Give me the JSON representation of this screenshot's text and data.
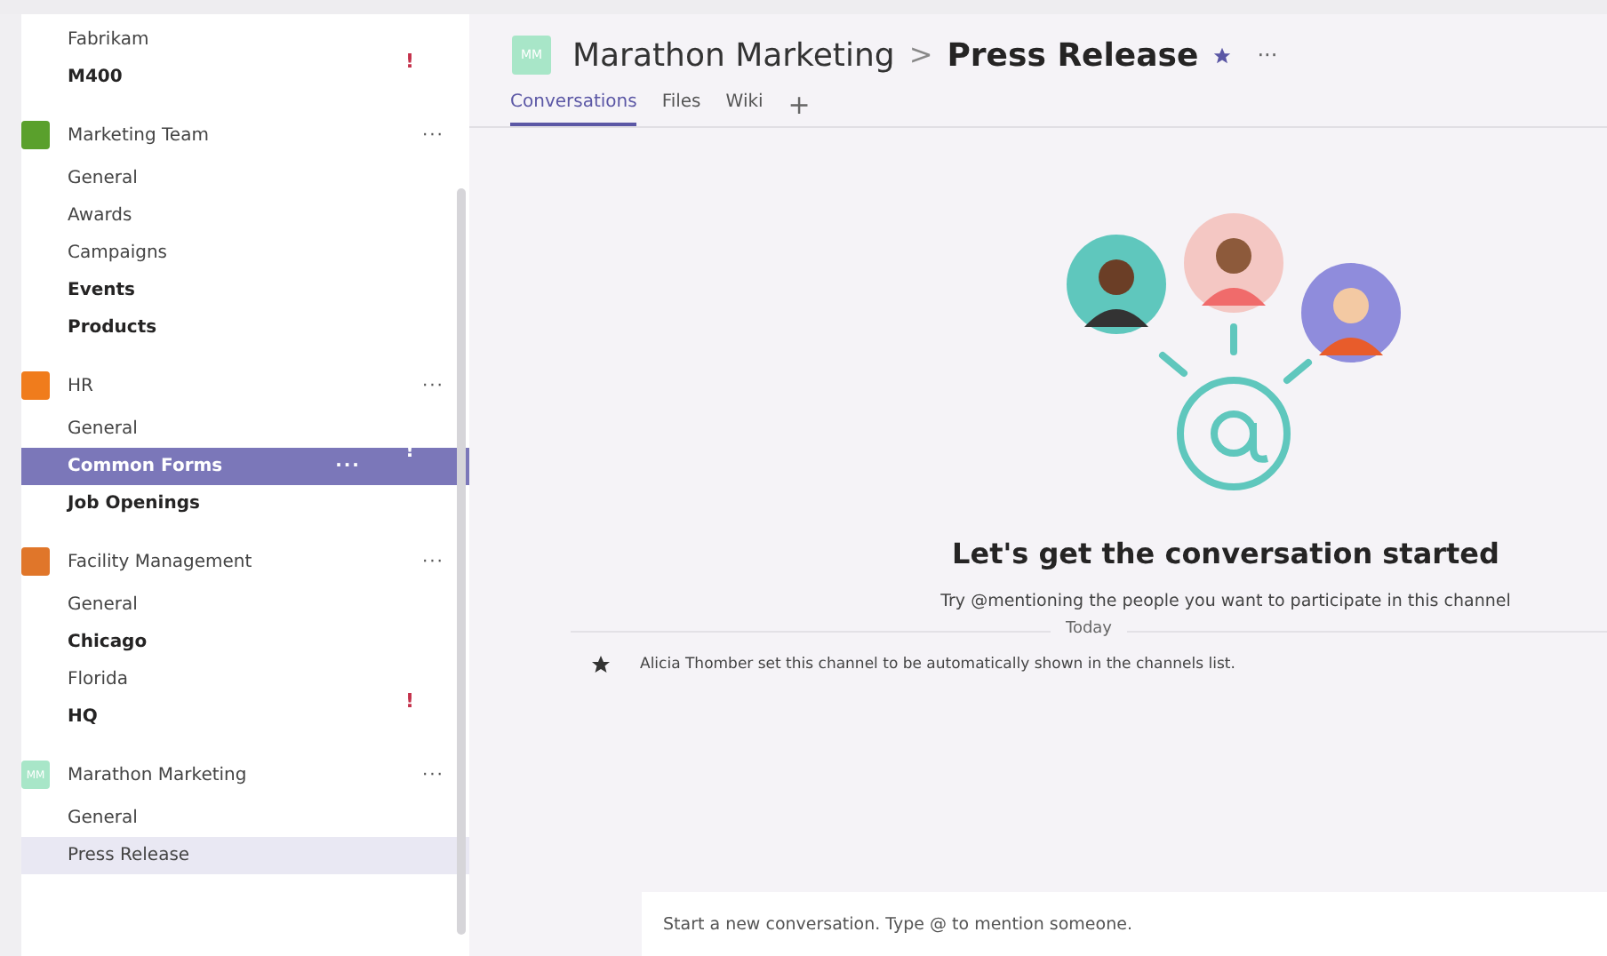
{
  "sidebar": {
    "teams": [
      {
        "channels": [
          {
            "name": "Fabrikam",
            "bold": false,
            "selected": false,
            "highlighted": false
          },
          {
            "name": "M400",
            "bold": true,
            "selected": false,
            "highlighted": false,
            "alert": "!"
          }
        ]
      },
      {
        "name": "Marketing Team",
        "color": "#5aa02c",
        "more": "···",
        "channels": [
          {
            "name": "General",
            "bold": false,
            "selected": false,
            "highlighted": false
          },
          {
            "name": "Awards",
            "bold": false,
            "selected": false,
            "highlighted": false
          },
          {
            "name": "Campaigns",
            "bold": false,
            "selected": false,
            "highlighted": false
          },
          {
            "name": "Events",
            "bold": true,
            "selected": false,
            "highlighted": false
          },
          {
            "name": "Products",
            "bold": true,
            "selected": false,
            "highlighted": false
          }
        ]
      },
      {
        "name": "HR",
        "color": "#f07c1c",
        "more": "···",
        "channels": [
          {
            "name": "General",
            "bold": false,
            "selected": false,
            "highlighted": false
          },
          {
            "name": "Common Forms",
            "bold": true,
            "selected": true,
            "highlighted": false,
            "more": "···",
            "alert": "!"
          },
          {
            "name": "Job Openings",
            "bold": true,
            "selected": false,
            "highlighted": false
          }
        ]
      },
      {
        "name": "Facility Management",
        "color": "#e0762a",
        "more": "···",
        "channels": [
          {
            "name": "General",
            "bold": false,
            "selected": false,
            "highlighted": false
          },
          {
            "name": "Chicago",
            "bold": true,
            "selected": false,
            "highlighted": false
          },
          {
            "name": "Florida",
            "bold": false,
            "selected": false,
            "highlighted": false
          },
          {
            "name": "HQ",
            "bold": true,
            "selected": false,
            "highlighted": false,
            "alert": "!"
          }
        ]
      },
      {
        "name": "Marathon Marketing",
        "color": "#a8e6c8",
        "avatar_text": "MM",
        "more": "···",
        "channels": [
          {
            "name": "General",
            "bold": false,
            "selected": false,
            "highlighted": false
          },
          {
            "name": "Press Release",
            "bold": false,
            "selected": false,
            "highlighted": true
          }
        ]
      }
    ]
  },
  "header": {
    "avatar_text": "MM",
    "team": "Marathon Marketing",
    "separator": ">",
    "channel": "Press Release",
    "favorite": true,
    "more": "···"
  },
  "tabs": [
    {
      "label": "Conversations",
      "selected": true
    },
    {
      "label": "Files",
      "selected": false
    },
    {
      "label": "Wiki",
      "selected": false
    }
  ],
  "add_tab": "+",
  "empty_state": {
    "heading": "Let's get the conversation started",
    "subtitle": "Try @mentioning the people you want to participate in this channel"
  },
  "divider": "Today",
  "system_message": "Alicia Thomber set this channel to be automatically shown in the channels list.",
  "compose": {
    "placeholder": "Start a new conversation. Type @ to mention someone."
  }
}
